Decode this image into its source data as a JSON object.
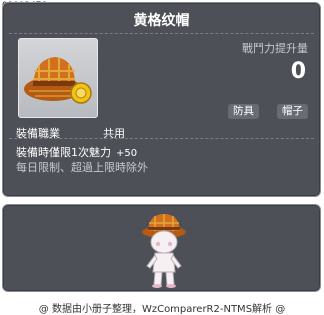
{
  "item_id": "01002476",
  "title": "黄格纹帽",
  "power": {
    "label": "戰鬥力提升量",
    "value": "0"
  },
  "badges": [
    "防具",
    "帽子"
  ],
  "job": {
    "label": "裝備職業",
    "value": "共用"
  },
  "effect": {
    "label": "裝備時僅限1次魅力",
    "value": "+50"
  },
  "limit_text": "每日限制、超過上限時除外",
  "footer": "@ 数据由小册子整理，WzComparerR2-NTMS解析 @",
  "icons": {
    "item": "plaid-hat-with-medal-icon",
    "avatar": "character-avatar-icon"
  },
  "colors": {
    "panel_bg": "#4e5058",
    "panel_border": "#8a8d97",
    "badge_bg": "#686b74",
    "hat_orange": "#d2701f",
    "hat_plaid_yellow": "#e7b43b"
  }
}
